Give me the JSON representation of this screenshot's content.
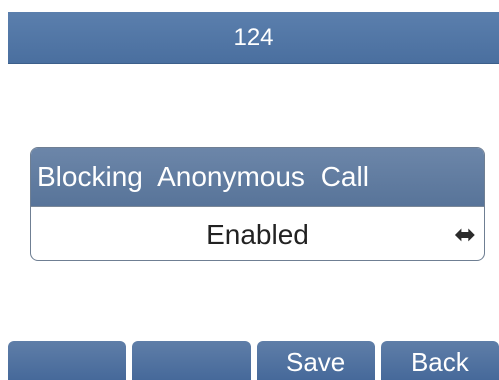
{
  "header": {
    "title": "124"
  },
  "setting": {
    "label": "Blocking Anonymous Call",
    "value": "Enabled",
    "switch_icon": "left-right-arrow-icon"
  },
  "softkeys": [
    {
      "label": ""
    },
    {
      "label": ""
    },
    {
      "label": "Save"
    },
    {
      "label": "Back"
    }
  ],
  "colors": {
    "title_bar": "#4f74a4",
    "softkey": "#4f74a4",
    "label_bar": "#6380a5"
  }
}
